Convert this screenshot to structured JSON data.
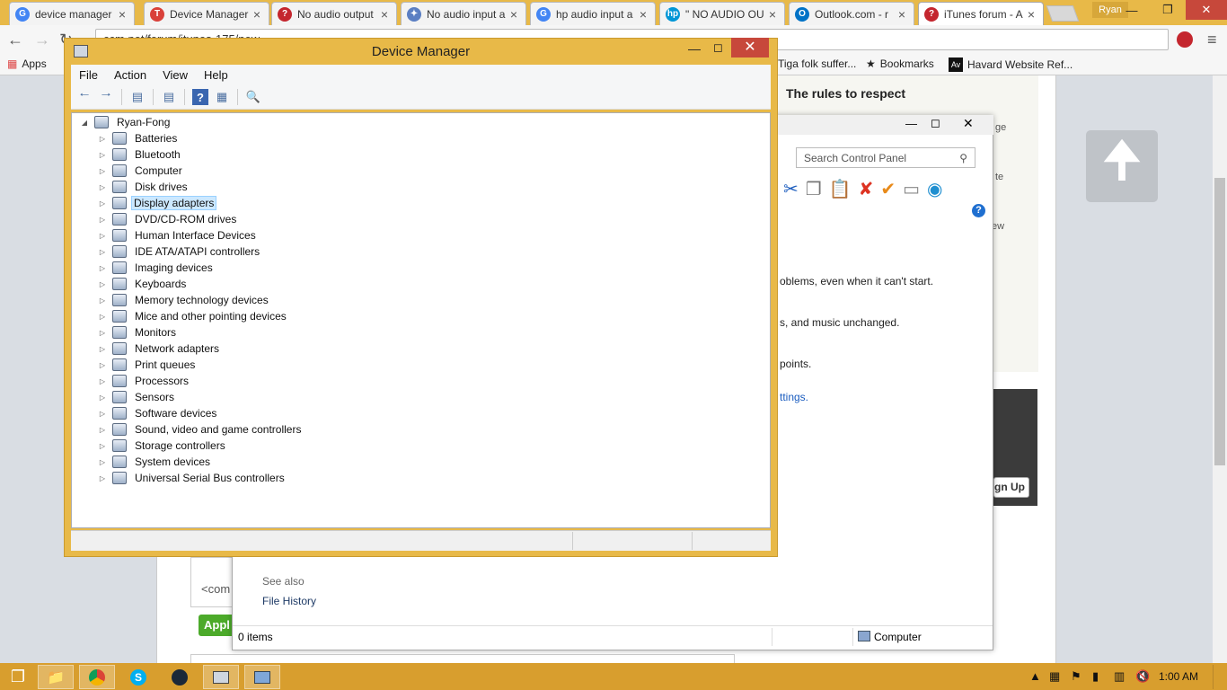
{
  "browser": {
    "tabs": [
      {
        "label": "device manager",
        "icon": "google-icon",
        "color": "#4285f4",
        "glyph": "G"
      },
      {
        "label": "Device Manager",
        "icon": "tumblr-t-icon",
        "color": "#d9413a",
        "glyph": "T"
      },
      {
        "label": "No audio output",
        "icon": "question-icon",
        "color": "#c4262e",
        "glyph": "?"
      },
      {
        "label": "No audio input a",
        "icon": "puzzle-icon",
        "color": "#5b7fc3",
        "glyph": "✦"
      },
      {
        "label": "hp audio input a",
        "icon": "google-icon",
        "color": "#4285f4",
        "glyph": "G"
      },
      {
        "label": "\" NO AUDIO OU",
        "icon": "hp-icon",
        "color": "#0096d6",
        "glyph": "hp"
      },
      {
        "label": "Outlook.com - r",
        "icon": "outlook-icon",
        "color": "#0072c6",
        "glyph": "O"
      },
      {
        "label": "iTunes forum - A",
        "icon": "question-icon",
        "color": "#c4262e",
        "glyph": "?"
      }
    ],
    "profile": "Ryan",
    "url": "ccm.net/forum/itunes-175/new",
    "bookmarks": {
      "apps": "Apps",
      "folk": "Tiga folk suffer...",
      "bookmarks": "Bookmarks",
      "harvard": "Havard Website Ref..."
    }
  },
  "webpage": {
    "rules_heading": "The rules to respect",
    "edge_snippets": [
      "ge",
      "te",
      "ew"
    ],
    "signup": "gn Up",
    "comment_placeholder": "<com",
    "apply": "Appl"
  },
  "control_panel": {
    "search_placeholder": "Search Control Panel",
    "lines": [
      "oblems, even when it can't start.",
      "s, and music unchanged.",
      "points."
    ],
    "link": "ttings.",
    "see_also": "See also",
    "file_history": "File History",
    "items_count": "0 items",
    "location": "Computer"
  },
  "device_manager": {
    "title": "Device Manager",
    "menu": [
      "File",
      "Action",
      "View",
      "Help"
    ],
    "root": "Ryan-Fong",
    "selected": "Display adapters",
    "categories": [
      "Batteries",
      "Bluetooth",
      "Computer",
      "Disk drives",
      "Display adapters",
      "DVD/CD-ROM drives",
      "Human Interface Devices",
      "IDE ATA/ATAPI controllers",
      "Imaging devices",
      "Keyboards",
      "Memory technology devices",
      "Mice and other pointing devices",
      "Monitors",
      "Network adapters",
      "Print queues",
      "Processors",
      "Sensors",
      "Software devices",
      "Sound, video and game controllers",
      "Storage controllers",
      "System devices",
      "Universal Serial Bus controllers"
    ]
  },
  "taskbar": {
    "clock": "1:00 AM",
    "items": [
      "start-icon",
      "file-explorer-icon",
      "chrome-icon",
      "skype-icon",
      "steam-icon",
      "device-manager-icon",
      "control-panel-icon"
    ]
  },
  "colors": {
    "accent": "#e8b948",
    "taskbar": "#d89e2e",
    "close": "#c7483b",
    "selection": "#cce8ff"
  }
}
